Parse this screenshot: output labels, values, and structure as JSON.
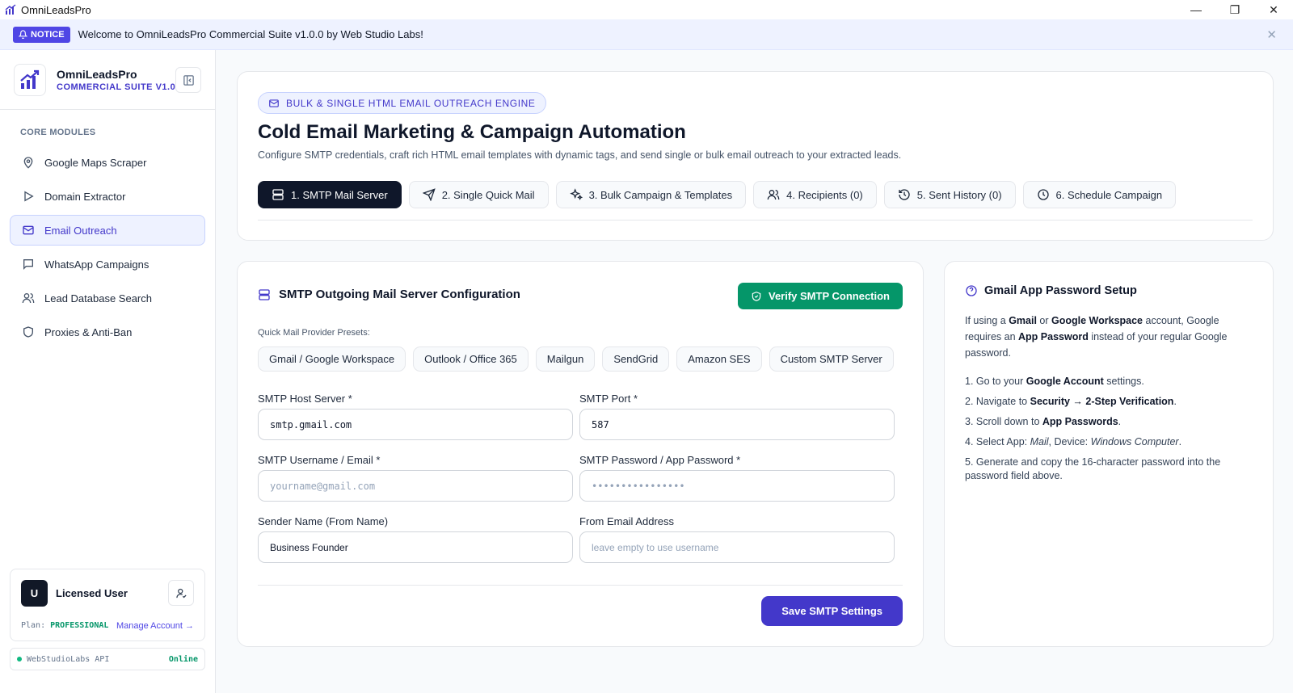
{
  "window": {
    "title": "OmniLeadsPro",
    "controls": {
      "minimize": "—",
      "restore": "❐",
      "close": "✕"
    }
  },
  "notice": {
    "badge": "NOTICE",
    "text": "Welcome to OmniLeadsPro Commercial Suite v1.0.0 by Web Studio Labs!",
    "close": "✕"
  },
  "sidebar": {
    "brand_name": "OmniLeadsPro",
    "brand_sub": "COMMERCIAL SUITE V1.0",
    "section_label": "CORE MODULES",
    "items": [
      {
        "label": "Google Maps Scraper",
        "icon": "map-pin-icon"
      },
      {
        "label": "Domain Extractor",
        "icon": "play-icon"
      },
      {
        "label": "Email Outreach",
        "icon": "mail-icon",
        "active": true
      },
      {
        "label": "WhatsApp Campaigns",
        "icon": "chat-icon"
      },
      {
        "label": "Lead Database Search",
        "icon": "users-icon"
      },
      {
        "label": "Proxies & Anti-Ban",
        "icon": "shield-icon"
      }
    ],
    "user": {
      "avatar": "U",
      "name": "Licensed User",
      "plan_label": "Plan:",
      "plan": "PROFESSIONAL",
      "manage": "Manage Account →"
    },
    "api": {
      "name": "WebStudioLabs API",
      "status": "Online"
    }
  },
  "hero": {
    "pill": "BULK & SINGLE HTML EMAIL OUTREACH ENGINE",
    "title": "Cold Email Marketing & Campaign Automation",
    "description": "Configure SMTP credentials, craft rich HTML email templates with dynamic tags, and send single or bulk email outreach to your extracted leads.",
    "tabs": [
      {
        "label": "1. SMTP Mail Server",
        "icon": "server-icon",
        "active": true
      },
      {
        "label": "2. Single Quick Mail",
        "icon": "send-icon"
      },
      {
        "label": "3. Bulk Campaign & Templates",
        "icon": "sparkles-icon"
      },
      {
        "label": "4. Recipients (0)",
        "icon": "users-icon"
      },
      {
        "label": "5. Sent History (0)",
        "icon": "history-icon"
      },
      {
        "label": "6. Schedule Campaign",
        "icon": "clock-icon"
      }
    ]
  },
  "smtp": {
    "title": "SMTP Outgoing Mail Server Configuration",
    "verify_button": "Verify SMTP Connection",
    "presets_label": "Quick Mail Provider Presets:",
    "presets": [
      "Gmail / Google Workspace",
      "Outlook / Office 365",
      "Mailgun",
      "SendGrid",
      "Amazon SES",
      "Custom SMTP Server"
    ],
    "fields": {
      "host": {
        "label": "SMTP Host Server *",
        "value": "smtp.gmail.com",
        "placeholder": ""
      },
      "port": {
        "label": "SMTP Port *",
        "value": "587",
        "placeholder": ""
      },
      "username": {
        "label": "SMTP Username / Email *",
        "value": "",
        "placeholder": "yourname@gmail.com"
      },
      "password": {
        "label": "SMTP Password / App Password *",
        "value": "",
        "placeholder": "••••••••••••••••"
      },
      "sender_name": {
        "label": "Sender Name (From Name)",
        "value": "Business Founder",
        "placeholder": ""
      },
      "from_email": {
        "label": "From Email Address",
        "value": "",
        "placeholder": "leave empty to use username"
      }
    },
    "save_button": "Save SMTP Settings"
  },
  "help": {
    "title": "Gmail App Password Setup",
    "intro": {
      "t1": "If using a ",
      "b1": "Gmail",
      "t2": " or ",
      "b2": "Google Workspace",
      "t3": " account, Google requires an ",
      "b3": "App Password",
      "t4": " instead of your regular Google password."
    },
    "steps": {
      "s1_a": "1. Go to your ",
      "s1_b": "Google Account",
      "s1_c": " settings.",
      "s2_a": "2. Navigate to ",
      "s2_b": "Security → 2-Step Verification",
      "s2_c": ".",
      "s3_a": "3. Scroll down to ",
      "s3_b": "App Passwords",
      "s3_c": ".",
      "s4_a": "4. Select App: ",
      "s4_b": "Mail",
      "s4_c": ", Device: ",
      "s4_d": "Windows Computer",
      "s4_e": ".",
      "s5": "5. Generate and copy the 16-character password into the password field above."
    }
  },
  "colors": {
    "accent": "#4338ca",
    "accent_light": "#eef2ff",
    "success": "#059669",
    "dark": "#0f172a"
  }
}
